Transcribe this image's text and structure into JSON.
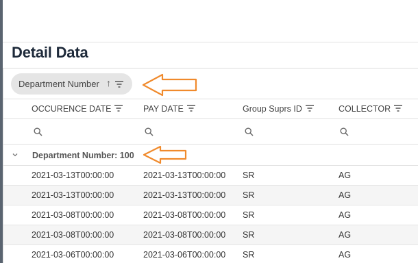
{
  "page": {
    "title": "Detail Data"
  },
  "group_panel": {
    "chip_label": "Department Number",
    "chip_sort_glyph": "↑",
    "chip_filter_icon": "filter-lines-icon"
  },
  "columns": [
    {
      "label": "OCCURENCE DATE",
      "icon": "filter-lines-icon"
    },
    {
      "label": "PAY DATE",
      "icon": "filter-lines-icon"
    },
    {
      "label": "Group Suprs ID",
      "icon": "filter-lines-icon"
    },
    {
      "label": "COLLECTOR",
      "icon": "filter-lines-icon"
    }
  ],
  "filter_row": {
    "icon": "search-icon"
  },
  "group_row": {
    "label": "Department Number: 100",
    "icon": "chevron-down-icon"
  },
  "rows": [
    {
      "occurence_date": "2021-03-13T00:00:00",
      "pay_date": "2021-03-13T00:00:00",
      "group_suprs_id": "SR",
      "collector": "AG"
    },
    {
      "occurence_date": "2021-03-13T00:00:00",
      "pay_date": "2021-03-13T00:00:00",
      "group_suprs_id": "SR",
      "collector": "AG"
    },
    {
      "occurence_date": "2021-03-08T00:00:00",
      "pay_date": "2021-03-08T00:00:00",
      "group_suprs_id": "SR",
      "collector": "AG"
    },
    {
      "occurence_date": "2021-03-08T00:00:00",
      "pay_date": "2021-03-08T00:00:00",
      "group_suprs_id": "SR",
      "collector": "AG"
    },
    {
      "occurence_date": "2021-03-06T00:00:00",
      "pay_date": "2021-03-06T00:00:00",
      "group_suprs_id": "SR",
      "collector": "AG"
    }
  ],
  "annotations": {
    "arrow_color": "#f08a2c",
    "arrow_icon": "left-arrow-outline-icon"
  }
}
